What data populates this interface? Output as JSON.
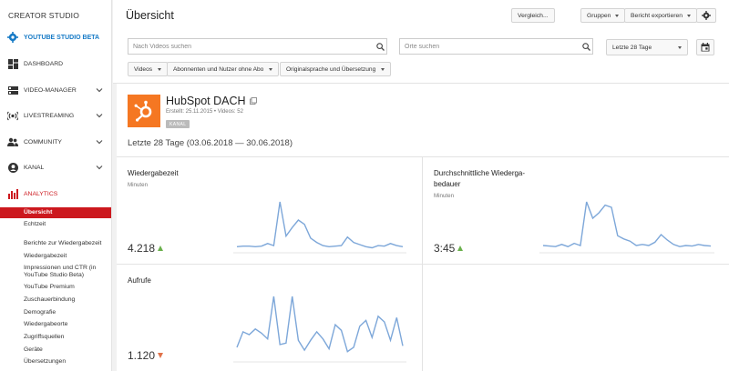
{
  "sidebar": {
    "brand": "CREATOR STUDIO",
    "studio_beta": "YOUTUBE STUDIO BETA",
    "items": [
      {
        "label": "DASHBOARD"
      },
      {
        "label": "VIDEO-MANAGER"
      },
      {
        "label": "LIVESTREAMING"
      },
      {
        "label": "COMMUNITY"
      },
      {
        "label": "KANAL"
      },
      {
        "label": "ANALYTICS"
      }
    ],
    "analytics_sub": {
      "active": "Übersicht",
      "realtime": "Echtzeit",
      "reports_heading": "Berichte zur Wiedergabezeit",
      "reports": [
        "Wiedergabezeit",
        "Impressionen und CTR (in",
        "YouTube Studio Beta)",
        "YouTube Premium",
        "Zuschauerbindung",
        "Demografie",
        "Wiedergabeorte",
        "Zugriffsquellen",
        "Geräte",
        "Übersetzungen"
      ]
    }
  },
  "header": {
    "title": "Übersicht",
    "compare": "Vergleich...",
    "groups": "Gruppen",
    "export": "Bericht exportieren"
  },
  "filters": {
    "video_search_placeholder": "Nach Videos suchen",
    "place_search_placeholder": "Orte suchen",
    "date_range": "Letzte 28 Tage",
    "videos": "Videos",
    "subscribers": "Abonnenten und Nutzer ohne Abo",
    "language": "Originalsprache und Übersetzung"
  },
  "channel": {
    "name": "HubSpot DACH",
    "meta": "Erstellt: 25.11.2015  •  Videos: 52",
    "badge": "KANAL",
    "period": "Letzte 28 Tage (03.06.2018 — 30.06.2018)"
  },
  "cards": {
    "watchtime": {
      "title": "Wiedergabezeit",
      "unit": "Minuten",
      "value": "4.218",
      "trend": "up",
      "series": [
        8,
        9,
        9,
        8,
        9,
        14,
        10,
        92,
        28,
        44,
        58,
        50,
        24,
        16,
        10,
        8,
        9,
        10,
        26,
        16,
        12,
        8,
        6,
        10,
        9,
        14,
        10,
        8
      ]
    },
    "avg_duration": {
      "title_line1": "Durchschnittliche Wiederga-",
      "title_line2": "bedauer",
      "unit": "Minuten",
      "value": "3:45",
      "trend": "up",
      "series": [
        10,
        9,
        8,
        12,
        8,
        14,
        10,
        90,
        60,
        70,
        84,
        80,
        28,
        22,
        18,
        10,
        12,
        10,
        16,
        30,
        20,
        12,
        8,
        10,
        9,
        12,
        10,
        9
      ]
    },
    "views": {
      "title": "Aufrufe",
      "value": "1.120",
      "trend": "down",
      "series": [
        18,
        40,
        36,
        44,
        38,
        30,
        90,
        22,
        24,
        90,
        28,
        14,
        28,
        40,
        30,
        16,
        50,
        42,
        12,
        18,
        48,
        56,
        32,
        62,
        54,
        28,
        60,
        20
      ]
    }
  },
  "colors": {
    "accent_red": "#cc181e",
    "link_blue": "#167ac6",
    "line_blue": "#7da7d9",
    "hubspot_orange": "#f57722",
    "up_green": "#6ab04c",
    "down_orange": "#e0724a"
  }
}
